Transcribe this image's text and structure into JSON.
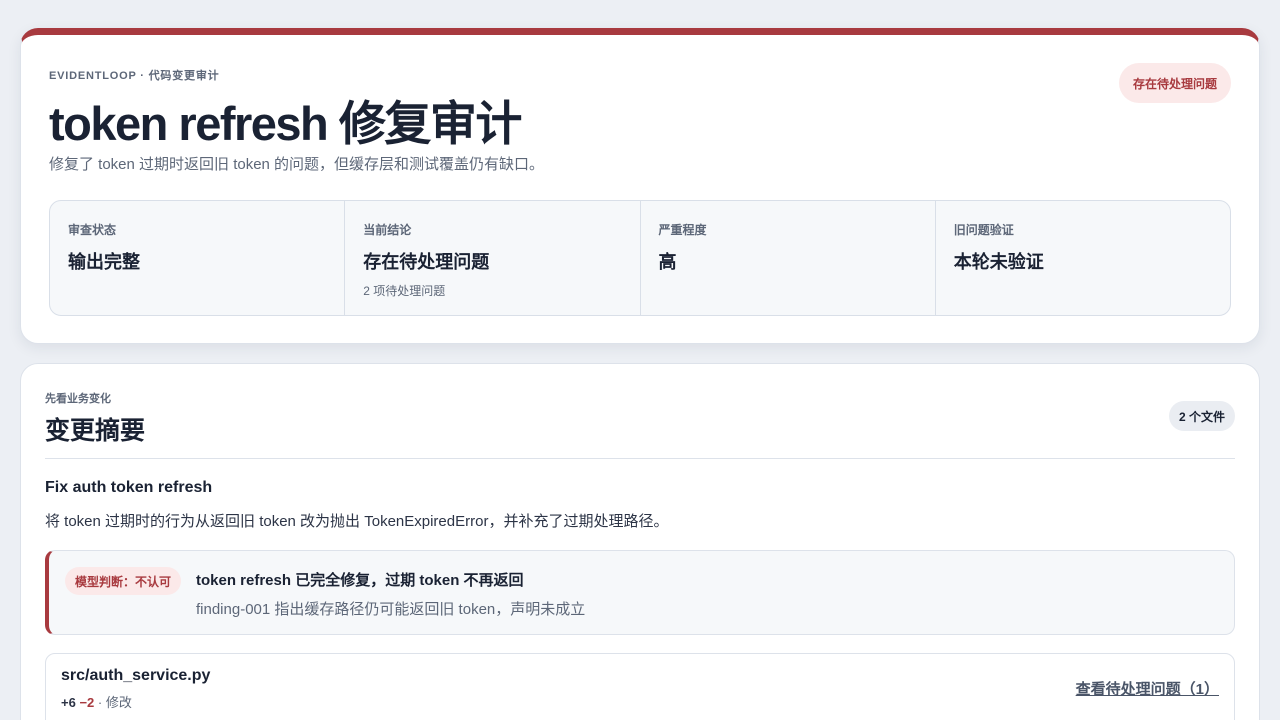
{
  "header": {
    "eyebrow": "EVIDENTLOOP · 代码变更审计",
    "status_badge": "存在待处理问题",
    "title": "token refresh 修复审计",
    "subtitle": "修复了 token 过期时返回旧 token 的问题，但缓存层和测试覆盖仍有缺口。"
  },
  "metrics": [
    {
      "label": "审查状态",
      "value": "输出完整",
      "note": ""
    },
    {
      "label": "当前结论",
      "value": "存在待处理问题",
      "note": "2 项待处理问题"
    },
    {
      "label": "严重程度",
      "value": "高",
      "note": ""
    },
    {
      "label": "旧问题验证",
      "value": "本轮未验证",
      "note": ""
    }
  ],
  "summary": {
    "eyebrow": "先看业务变化",
    "title": "变更摘要",
    "files_count": "2 个文件",
    "commit_title": "Fix auth token refresh",
    "commit_desc": "将 token 过期时的行为从返回旧 token 改为抛出 TokenExpiredError，并补充了过期处理路径。",
    "claim": {
      "tag": "模型判断：不认可",
      "title": "token refresh 已完全修复，过期 token 不再返回",
      "note": "finding-001 指出缓存路径仍可能返回旧 token，声明未成立"
    },
    "file": {
      "name": "src/auth_service.py",
      "additions": "+6",
      "deletions": "−2",
      "change_type": "· 修改",
      "link": "查看待处理问题（1）"
    }
  },
  "colors": {
    "accent": "#a83a3f",
    "background": "#eceff4",
    "text": "#1a2233",
    "muted": "#5d6778"
  }
}
